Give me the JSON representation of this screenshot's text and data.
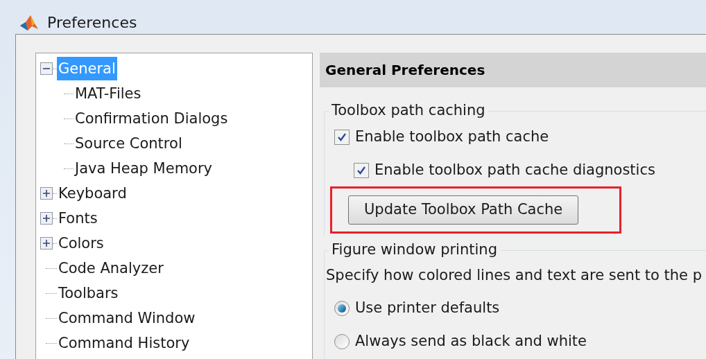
{
  "window": {
    "title": "Preferences"
  },
  "tree": [
    {
      "label": "General",
      "selected": true,
      "expanded": true,
      "children": [
        {
          "label": "MAT-Files",
          "selected": false
        },
        {
          "label": "Confirmation Dialogs",
          "selected": false
        },
        {
          "label": "Source Control",
          "selected": false
        },
        {
          "label": "Java Heap Memory",
          "selected": false
        }
      ]
    },
    {
      "label": "Keyboard",
      "selected": false,
      "expanded": false
    },
    {
      "label": "Fonts",
      "selected": false,
      "expanded": false
    },
    {
      "label": "Colors",
      "selected": false,
      "expanded": false
    },
    {
      "label": "Code Analyzer",
      "selected": false
    },
    {
      "label": "Toolbars",
      "selected": false
    },
    {
      "label": "Command Window",
      "selected": false
    },
    {
      "label": "Command History",
      "selected": false
    }
  ],
  "panel": {
    "title": "General Preferences",
    "groups": [
      {
        "title": "Toolbox path caching",
        "items": [
          {
            "kind": "checkbox",
            "label": "Enable toolbox path cache",
            "checked": true
          },
          {
            "kind": "checkbox",
            "label": "Enable toolbox path cache diagnostics",
            "checked": true,
            "indent": true
          },
          {
            "kind": "button",
            "label": "Update Toolbox Path Cache",
            "highlighted": true
          }
        ]
      },
      {
        "title": "Figure window printing",
        "items": [
          {
            "kind": "text",
            "label": "Specify how colored lines and text are sent to the p"
          },
          {
            "kind": "radio",
            "label": "Use printer defaults",
            "selected": true
          },
          {
            "kind": "radio",
            "label": "Always send as black and white",
            "selected": false
          }
        ]
      }
    ]
  }
}
